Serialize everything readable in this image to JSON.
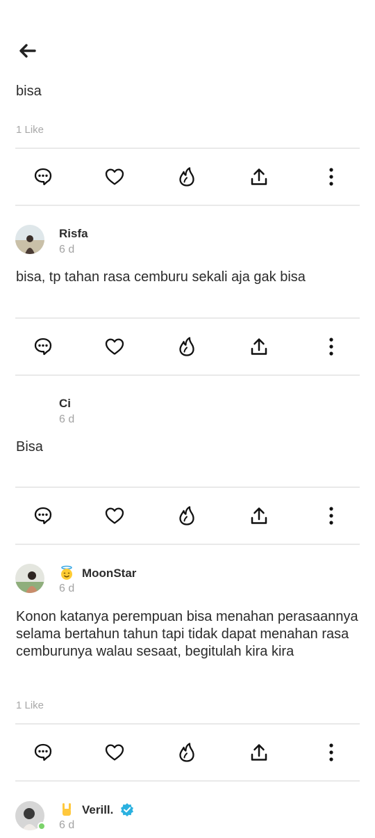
{
  "icons": {
    "back": "arrow-left-icon",
    "comment": "comment-bubble-icon",
    "like": "heart-icon",
    "fire": "flame-icon",
    "share": "share-upload-icon",
    "more": "more-vertical-icon"
  },
  "colors": {
    "divider": "#e9e9e9",
    "muted": "#a8a8a8",
    "verified": "#2bb1e0",
    "online": "#7bd36a"
  },
  "thread": {
    "top_post": {
      "text": "bisa",
      "likes": "1 Like"
    },
    "comments": [
      {
        "name": "Risfa",
        "time": "6 d",
        "text": "bisa, tp tahan rasa cemburu sekali aja gak bisa"
      },
      {
        "name": "Ci",
        "time": "6 d",
        "text": "Bisa"
      },
      {
        "name": "MoonStar",
        "time": "6 d",
        "badge": "smiling-face-with-halo-emoji",
        "text": "Konon katanya perempuan bisa menahan perasaannya selama bertahun tahun tapi tidak dapat menahan rasa cemburunya walau sesaat, begitulah kira kira",
        "likes": "1 Like"
      },
      {
        "name": "Verill.",
        "time": "6 d",
        "badge": "sign-of-horns-emoji",
        "verified": true
      }
    ]
  }
}
